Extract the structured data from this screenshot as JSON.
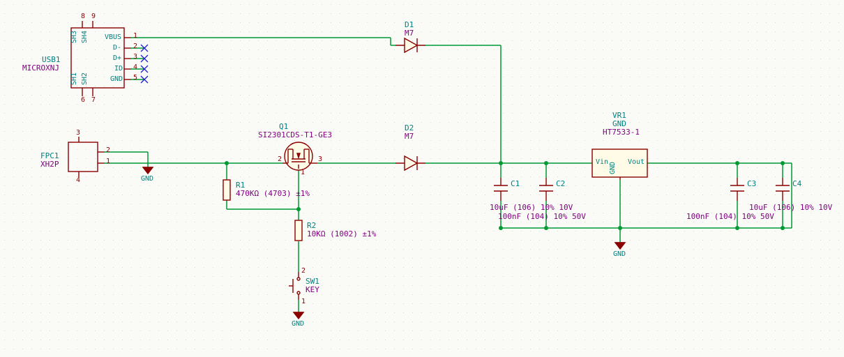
{
  "components": {
    "usb": {
      "ref": "USB1",
      "val": "MICROXNJ",
      "pins": {
        "p1": "1",
        "p2": "2",
        "p3": "3",
        "p4": "4",
        "p5": "5",
        "p6": "6",
        "p7": "7",
        "p8": "8",
        "p9": "9"
      },
      "pinnames": {
        "vbus": "VBUS",
        "dm": "D-",
        "dp": "D+",
        "id": "ID",
        "gnd": "GND",
        "sh1": "SH1",
        "sh2": "SH2",
        "sh3": "SH3",
        "sh4": "SH4"
      }
    },
    "fpc": {
      "ref": "FPC1",
      "val": "XH2P",
      "pins": {
        "p1": "1",
        "p2": "2",
        "p3": "3",
        "p4": "4"
      }
    },
    "d1": {
      "ref": "D1",
      "val": "M7"
    },
    "d2": {
      "ref": "D2",
      "val": "M7"
    },
    "q1": {
      "ref": "Q1",
      "val": "SI2301CDS-T1-GE3",
      "pins": {
        "p1": "1",
        "p2": "2",
        "p3": "3"
      }
    },
    "r1": {
      "ref": "R1",
      "val": "470KΩ (4703) ±1%"
    },
    "r2": {
      "ref": "R2",
      "val": "10KΩ (1002) ±1%"
    },
    "sw1": {
      "ref": "SW1",
      "val": "KEY",
      "pins": {
        "p1": "1",
        "p2": "2"
      }
    },
    "c1": {
      "ref": "C1",
      "val": "10uF (106) 10% 10V"
    },
    "c2": {
      "ref": "C2",
      "val": "100nF (104) 10% 50V"
    },
    "c3": {
      "ref": "C3",
      "val": "100nF (104) 10% 50V"
    },
    "c4": {
      "ref": "C4",
      "val": "10uF (106) 10% 10V"
    },
    "vr1": {
      "ref": "VR1",
      "val": "HT7533-1",
      "gnd": "GND",
      "pinnames": {
        "vin": "Vin",
        "vout": "Vout",
        "gnd": "GND"
      }
    }
  },
  "power": {
    "gnd": "GND"
  },
  "chart_data": null
}
